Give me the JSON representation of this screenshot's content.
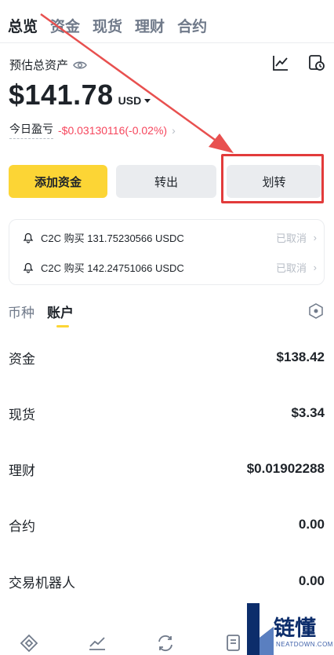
{
  "top_tabs": [
    "总览",
    "资金",
    "现货",
    "理财",
    "合约"
  ],
  "header": {
    "estimated_label": "预估总资产",
    "balance": "$141.78",
    "currency": "USD",
    "pnl_label": "今日盈亏",
    "pnl_value": "-$0.03130116(-0.02%)"
  },
  "actions": {
    "add_funds": "添加资金",
    "withdraw": "转出",
    "transfer": "划转"
  },
  "notifications": [
    {
      "text": "C2C 购买 131.75230566 USDC",
      "status": "已取消"
    },
    {
      "text": "C2C 购买 142.24751066 USDC",
      "status": "已取消"
    }
  ],
  "sub_tabs": [
    "币种",
    "账户"
  ],
  "accounts": [
    {
      "name": "资金",
      "value": "$138.42"
    },
    {
      "name": "现货",
      "value": "$3.34"
    },
    {
      "name": "理财",
      "value": "$0.01902288"
    },
    {
      "name": "合约",
      "value": "0.00"
    },
    {
      "name": "交易机器人",
      "value": "0.00"
    }
  ],
  "watermark": {
    "title": "链懂",
    "subtitle": "NEATDOWN.COM"
  },
  "colors": {
    "accent": "#fcd535",
    "loss": "#f6465d",
    "annotation": "#e23b3b",
    "muted": "#b7bdc6"
  },
  "icons": [
    "eye-icon",
    "chart-icon",
    "history-icon",
    "bell-icon",
    "hexagon-icon",
    "nav-home-icon",
    "nav-markets-icon",
    "nav-trade-icon",
    "nav-assets-icon"
  ]
}
